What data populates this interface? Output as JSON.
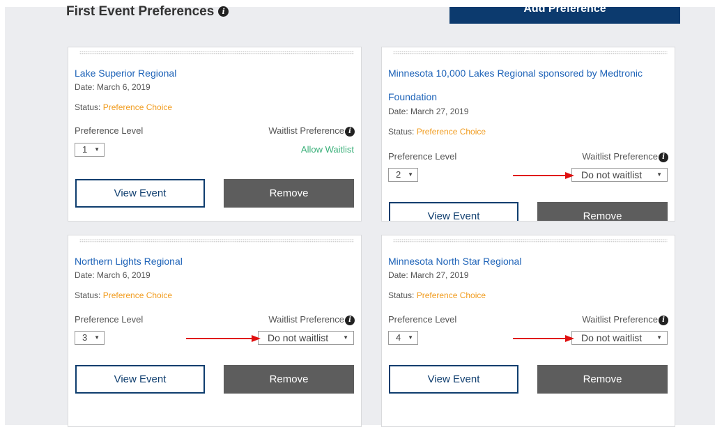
{
  "section": {
    "title": "First Event Preferences",
    "add_button_label": "Add Preference"
  },
  "labels": {
    "date_prefix": "Date: ",
    "status_prefix": "Status: ",
    "preference_level": "Preference Level",
    "waitlist_preference": "Waitlist Preference",
    "view_event": "View Event",
    "remove": "Remove"
  },
  "cards": [
    {
      "event_name": "Lake Superior Regional",
      "date": "March 6, 2019",
      "status": "Preference Choice",
      "preference_level": "1",
      "waitlist_text": "Allow Waitlist"
    },
    {
      "event_name": "Minnesota 10,000 Lakes Regional sponsored by Medtronic Foundation",
      "date": "March 27, 2019",
      "status": "Preference Choice",
      "preference_level": "2",
      "waitlist_text": "Do not waitlist"
    },
    {
      "event_name": "Northern Lights Regional",
      "date": "March 6, 2019",
      "status": "Preference Choice",
      "preference_level": "3",
      "waitlist_text": "Do not waitlist"
    },
    {
      "event_name": "Minnesota North Star Regional",
      "date": "March 27, 2019",
      "status": "Preference Choice",
      "preference_level": "4",
      "waitlist_text": "Do not waitlist"
    }
  ],
  "colors": {
    "link_blue": "#1e63b8",
    "status_orange": "#f19c1f",
    "allow_green": "#3bb07a",
    "navy": "#0e3d6e",
    "remove_gray": "#5d5d5d",
    "annotation_red": "#e01010"
  },
  "icons": {
    "info": "info-circle-icon",
    "dropdown": "chevron-down-icon",
    "annotation": "red-arrow-icon"
  }
}
